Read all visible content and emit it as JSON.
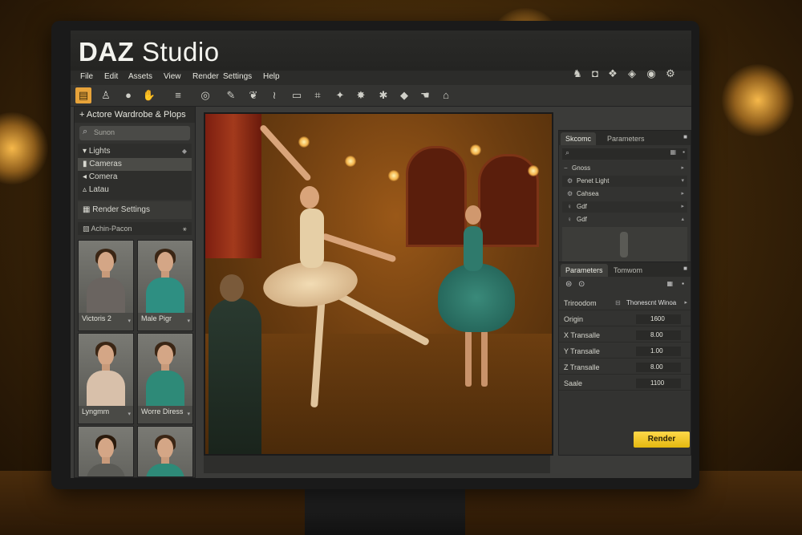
{
  "app": {
    "name_bold": "DAZ",
    "name_regular": "Studio"
  },
  "menu": [
    "File",
    "Edit",
    "Assets",
    "View",
    "Render",
    "Settings",
    "Help"
  ],
  "top_right_icons": [
    "figure-icon",
    "camera-icon",
    "cube-icon",
    "prop-icon",
    "light-icon",
    "settings-icon"
  ],
  "toolbar_icons": [
    "folder-icon",
    "pose-icon",
    "sphere-icon",
    "hand-icon",
    "layers-icon",
    "eye-icon",
    "brush-icon",
    "leaf-icon",
    "wave-icon",
    "frame-icon",
    "crop-icon",
    "pin-icon",
    "bomb-icon",
    "spark-icon",
    "eraser-icon",
    "hand-grab-icon",
    "tag-icon"
  ],
  "left_panel": {
    "title": "Actore Wardrobe & Plops",
    "search_placeholder": "Sunon",
    "tree": [
      {
        "label": "Lights",
        "selected": false
      },
      {
        "label": "Cameras",
        "selected": true
      },
      {
        "label": "Comera",
        "selected": false
      },
      {
        "label": "Latau",
        "selected": false
      }
    ],
    "render_settings_label": "Render Settings",
    "sub_header": "Achin-Pacon",
    "thumbnails": [
      {
        "label": "Victoris 2",
        "color": "#6a6460"
      },
      {
        "label": "Male Pigr",
        "color": "#2e8f82"
      },
      {
        "label": "Lyngmm",
        "color": "#d8c0aa"
      },
      {
        "label": "Worre Diress",
        "color": "#2e8a78"
      },
      {
        "label": "",
        "color": "#5a5a55"
      },
      {
        "label": "",
        "color": "#2e8a78"
      }
    ]
  },
  "scene_panel": {
    "tabs": [
      "Skcomc",
      "Parameters"
    ],
    "group": "Gnoss",
    "items": [
      {
        "icon": "gear-icon",
        "label": "Penet Light"
      },
      {
        "icon": "gear-icon",
        "label": "Cahsea"
      },
      {
        "icon": "figure-icon",
        "label": "Gdf"
      },
      {
        "icon": "figure-icon",
        "label": "Gdf"
      }
    ]
  },
  "params_panel": {
    "tabs": [
      "Parameters",
      "Tomwom"
    ],
    "section": "Triroodom",
    "section_extra": "Thonescnt Winoa",
    "rows": [
      {
        "label": "Origin",
        "value": "1600"
      },
      {
        "label": "X Transalle",
        "value": "8.00"
      },
      {
        "label": "Y Transalle",
        "value": "1.00"
      },
      {
        "label": "Z Transalle",
        "value": "8.00"
      },
      {
        "label": "Saale",
        "value": "1100"
      }
    ]
  },
  "render_button": "Render",
  "colors": {
    "accent": "#e7a33a",
    "render": "#f0c418",
    "panel": "#333331"
  }
}
